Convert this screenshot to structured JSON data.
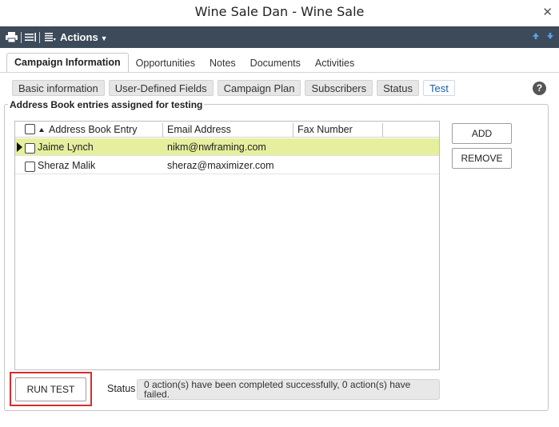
{
  "window": {
    "title": "Wine Sale Dan - Wine Sale",
    "close_glyph": "✕"
  },
  "toolbar": {
    "actions_label": "Actions",
    "icons": [
      "printer-icon",
      "list-icon",
      "actions-list-icon",
      "arrow-up-icon",
      "arrow-down-icon"
    ]
  },
  "tabs": [
    {
      "label": "Campaign Information",
      "active": true
    },
    {
      "label": "Opportunities"
    },
    {
      "label": "Notes"
    },
    {
      "label": "Documents"
    },
    {
      "label": "Activities"
    }
  ],
  "subtabs": [
    {
      "label": "Basic information"
    },
    {
      "label": "User-Defined Fields"
    },
    {
      "label": "Campaign Plan"
    },
    {
      "label": "Subscribers"
    },
    {
      "label": "Status"
    },
    {
      "label": "Test",
      "active": true
    }
  ],
  "help_glyph": "?",
  "section": {
    "legend": "Address Book entries assigned for testing"
  },
  "grid": {
    "columns": [
      "Address Book Entry",
      "Email Address",
      "Fax Number"
    ],
    "rows": [
      {
        "entry": "Jaime Lynch",
        "email": "nikm@nwframing.com",
        "fax": "",
        "selected": true
      },
      {
        "entry": "Sheraz Malik",
        "email": "sheraz@maximizer.com",
        "fax": ""
      }
    ]
  },
  "buttons": {
    "add": "ADD",
    "remove": "REMOVE",
    "run_test": "RUN TEST"
  },
  "status": {
    "label": "Status",
    "text": "0 action(s) have been completed successfully, 0 action(s) have failed."
  },
  "colors": {
    "toolbar_bg": "#3c4a5a",
    "selected_row": "#e6ef9e",
    "highlight_border": "#d62d2d",
    "active_subtab_text": "#1a5fa8"
  }
}
